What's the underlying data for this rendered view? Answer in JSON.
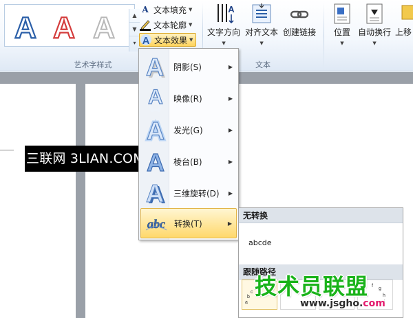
{
  "ribbon": {
    "wordart_group_label": "艺术字样式",
    "text_group_label": "文本",
    "text_fill": "文本填充",
    "text_outline": "文本轮廓",
    "text_effects": "文本效果",
    "text_direction": "文字方向",
    "align_text": "对齐文本",
    "create_link": "创建链接",
    "position": "位置",
    "wrap_text": "自动换行",
    "bring_forward": "上移"
  },
  "watermark": "三联网 3LIAN.COM",
  "menu": {
    "items": [
      {
        "label": "阴影(S)",
        "icon": "shadow-a-icon"
      },
      {
        "label": "映像(R)",
        "icon": "reflection-a-icon"
      },
      {
        "label": "发光(G)",
        "icon": "glow-a-icon"
      },
      {
        "label": "棱台(B)",
        "icon": "bevel-a-icon"
      },
      {
        "label": "三维旋转(D)",
        "icon": "3d-rotation-a-icon"
      },
      {
        "label": "转换(T)",
        "icon": "transform-abc-icon"
      }
    ]
  },
  "submenu": {
    "no_transform_header": "无转换",
    "no_transform_sample": "abcde",
    "follow_path_header": "跟随路径"
  },
  "brand": {
    "name": "技术员联盟",
    "url_main": "www.jsgho.",
    "url_tld": "com"
  },
  "colors": {
    "highlight": "#ffd86b",
    "wordart_blue": "#2b5fa8",
    "wordart_red": "#d43c3c"
  }
}
